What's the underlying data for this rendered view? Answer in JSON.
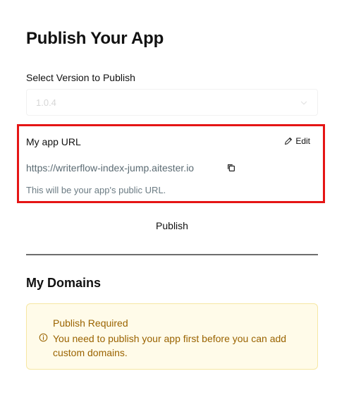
{
  "page": {
    "title": "Publish Your App"
  },
  "version": {
    "label": "Select Version to Publish",
    "selected": "1.0.4"
  },
  "app_url": {
    "heading": "My app URL",
    "edit_label": "Edit",
    "url": "https://writerflow-index-jump.aitester.io",
    "help": "This will be your app's public URL."
  },
  "publish": {
    "label": "Publish"
  },
  "domains": {
    "heading": "My Domains",
    "alert_title": "Publish Required",
    "alert_body": "You need to publish your app first before you can add custom domains."
  },
  "colors": {
    "highlight_border": "#e51515",
    "warning_text": "#9a6300",
    "warning_bg": "#fffbe9"
  },
  "icons": {
    "edit": "pencil-icon",
    "copy": "copy-icon",
    "info": "info-icon",
    "chevron": "chevron-down-icon"
  }
}
